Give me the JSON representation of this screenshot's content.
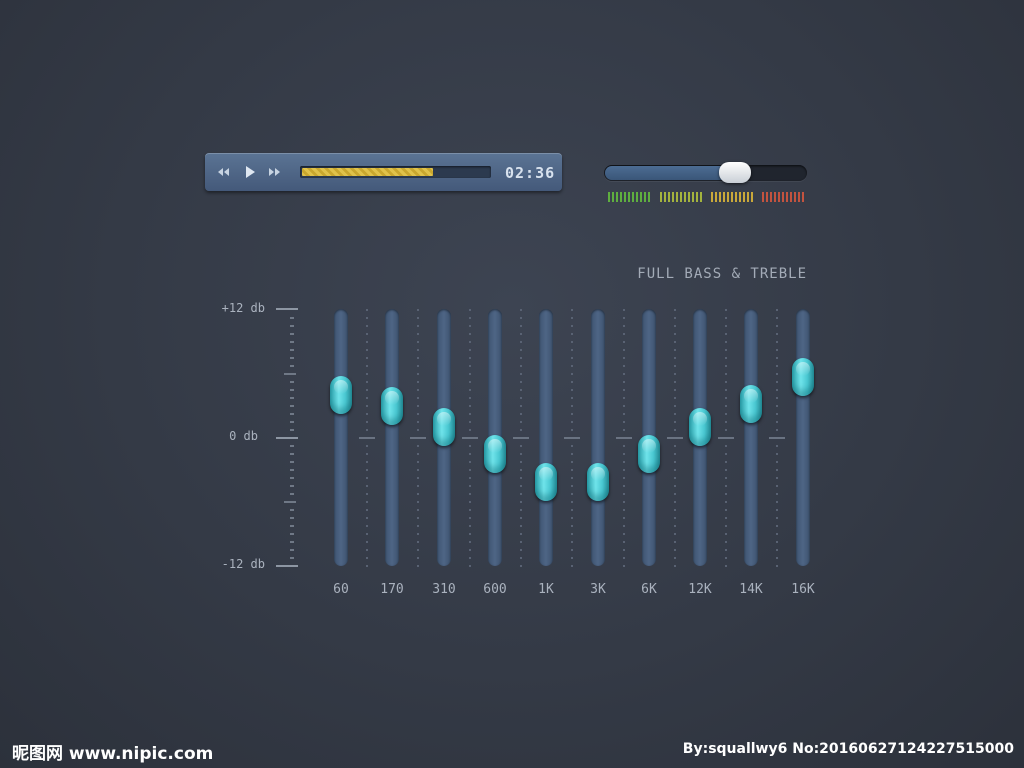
{
  "player": {
    "time": "02:36",
    "progress": 0.7,
    "controls": [
      "rewind-icon",
      "play-icon",
      "fast-forward-icon"
    ]
  },
  "volume": {
    "level": 0.65,
    "meter_colors": [
      "#5fae3f",
      "#a3b33e",
      "#c9a83a",
      "#c3533f"
    ]
  },
  "equalizer": {
    "preset": "FULL BASS & TREBLE",
    "scale": {
      "max": "+12 db",
      "mid": "0 db",
      "min": "-12 db"
    },
    "bands": [
      {
        "label": "60",
        "gain": 4.2
      },
      {
        "label": "170",
        "gain": 3.1
      },
      {
        "label": "310",
        "gain": 1.0
      },
      {
        "label": "600",
        "gain": -1.6
      },
      {
        "label": "1K",
        "gain": -4.4
      },
      {
        "label": "3K",
        "gain": -4.4
      },
      {
        "label": "6K",
        "gain": -1.6
      },
      {
        "label": "12K",
        "gain": 1.0
      },
      {
        "label": "14K",
        "gain": 3.3
      },
      {
        "label": "16K",
        "gain": 5.9
      }
    ],
    "accent": "#4fcad3"
  },
  "watermark": {
    "left": "昵图网 www.nipic.com",
    "right": "By:squallwy6 No:20160627124227515000"
  }
}
